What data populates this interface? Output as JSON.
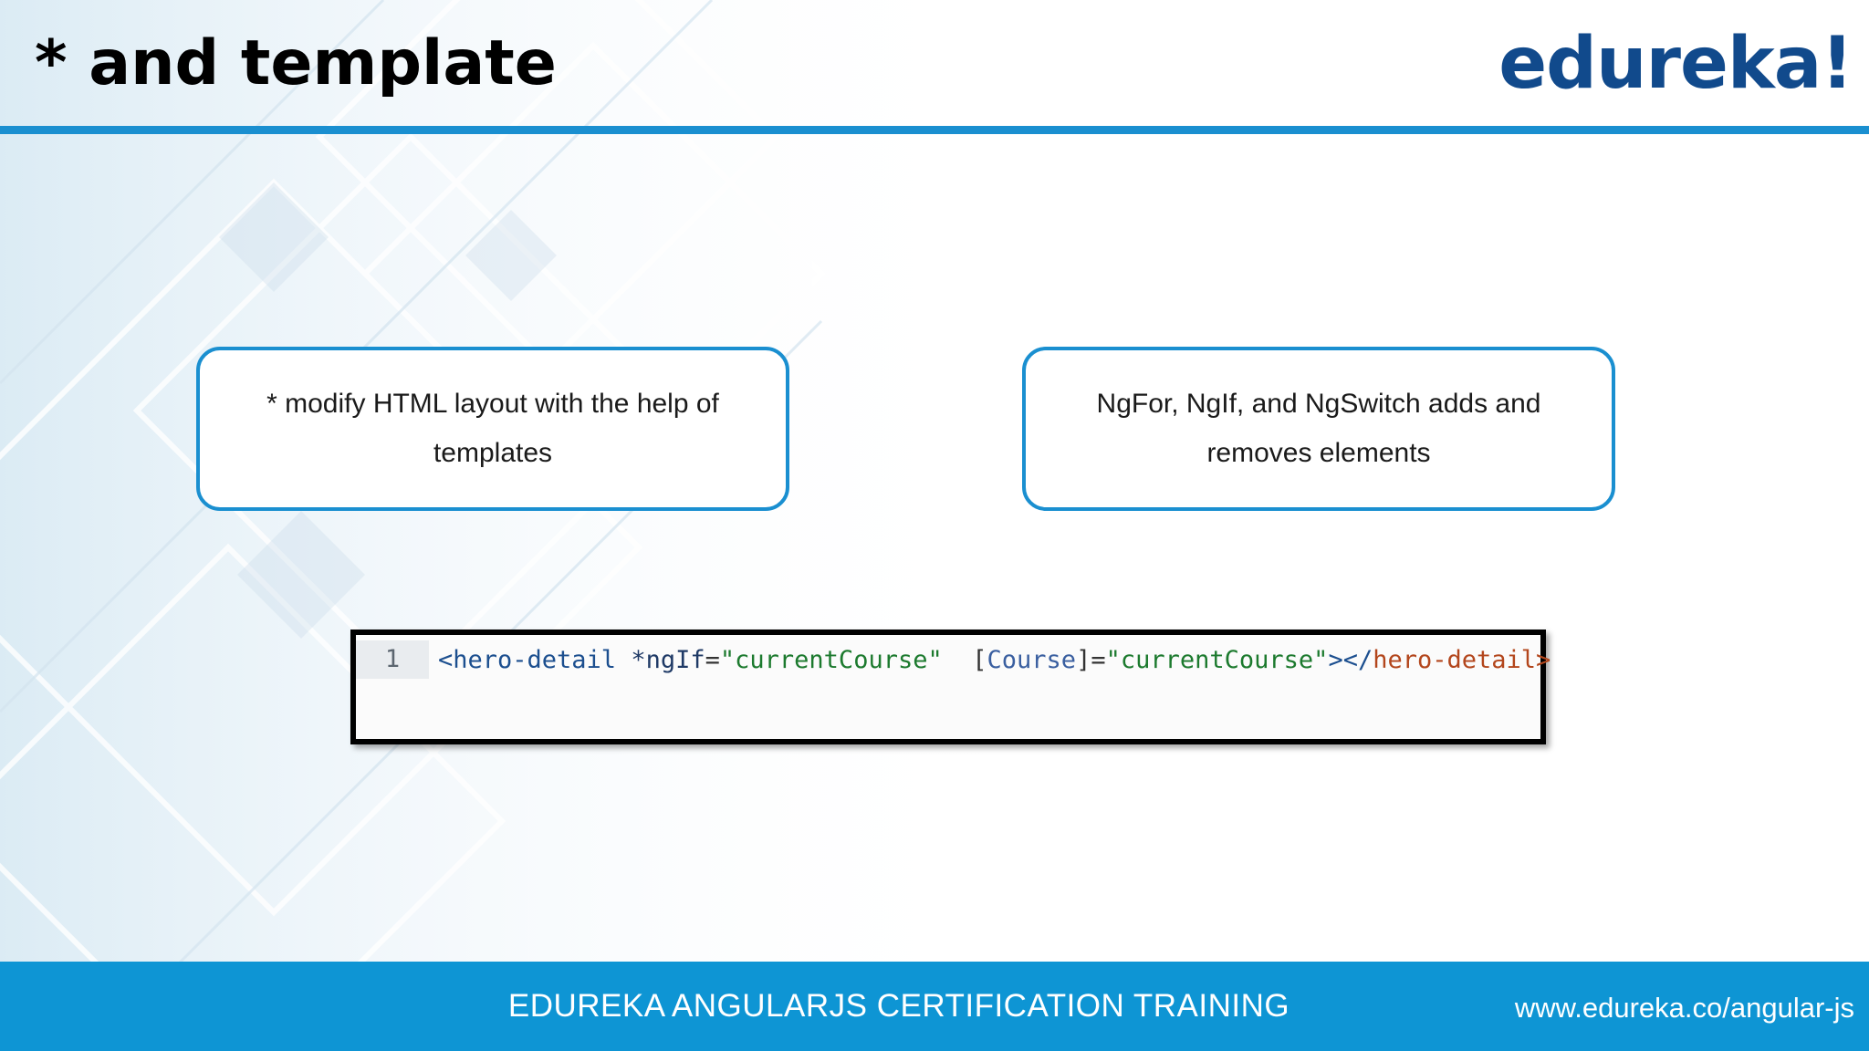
{
  "slide": {
    "title": "* and template",
    "logo_text": "edureka!"
  },
  "boxes": [
    {
      "text": "* modify HTML layout with the help of templates"
    },
    {
      "text": "NgFor, NgIf, and NgSwitch adds and removes elements"
    }
  ],
  "code": {
    "line_number": "1",
    "tokens": {
      "open_tag": "<hero-detail",
      "attr1": " *ngIf",
      "eq1": "=",
      "str1": "\"currentCourse\"",
      "bracket_open": "  [",
      "attr2": "Course",
      "bracket_close": "]",
      "eq2": "=",
      "str2": "\"currentCourse\"",
      "gt": ">",
      "close_open": "</",
      "close_tag": "hero-detail>"
    }
  },
  "footer": {
    "title": "EDUREKA ANGULARJS CERTIFICATION TRAINING",
    "url": "www.edureka.co/angular-js"
  },
  "colors": {
    "accent": "#1a8fd0",
    "footer_bg": "#0e95d4",
    "logo": "#114a8c"
  }
}
